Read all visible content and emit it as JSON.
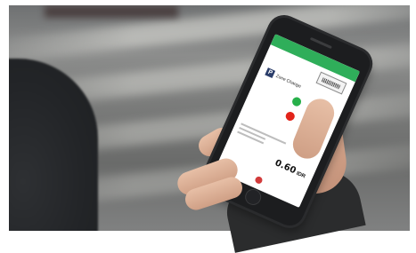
{
  "scene": {
    "description_tag": "hand holding smartphone with parking app on street",
    "colors": {
      "app_bar": "#2fae5a",
      "status_good": "#27b04a",
      "status_bad": "#e2231a"
    }
  },
  "app": {
    "zone_label": "Zone Change",
    "zone_icon_letter": "P",
    "amount": "0.60",
    "currency": "IDR"
  }
}
